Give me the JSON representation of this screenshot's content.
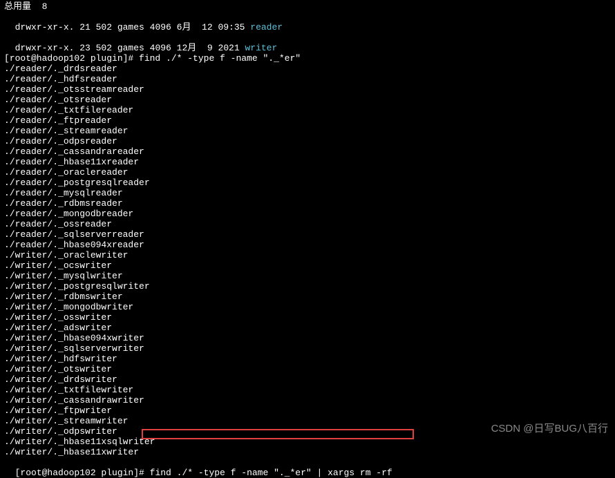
{
  "header": {
    "usage": "总用量  8",
    "ls1_prefix": "drwxr-xr-x. 21 502 games 4096 6月  12 09:35 ",
    "ls1_dir": "reader",
    "ls2_prefix": "drwxr-xr-x. 23 502 games 4096 12月  9 2021 ",
    "ls2_dir": "writer",
    "prompt1": "[root@hadoop102 plugin]# find ./* -type f -name \"._*er\""
  },
  "results": [
    "./reader/._drdsreader",
    "./reader/._hdfsreader",
    "./reader/._otsstreamreader",
    "./reader/._otsreader",
    "./reader/._txtfilereader",
    "./reader/._ftpreader",
    "./reader/._streamreader",
    "./reader/._odpsreader",
    "./reader/._cassandrareader",
    "./reader/._hbase11xreader",
    "./reader/._oraclereader",
    "./reader/._postgresqlreader",
    "./reader/._mysqlreader",
    "./reader/._rdbmsreader",
    "./reader/._mongodbreader",
    "./reader/._ossreader",
    "./reader/._sqlserverreader",
    "./reader/._hbase094xreader",
    "./writer/._oraclewriter",
    "./writer/._ocswriter",
    "./writer/._mysqlwriter",
    "./writer/._postgresqlwriter",
    "./writer/._rdbmswriter",
    "./writer/._mongodbwriter",
    "./writer/._osswriter",
    "./writer/._adswriter",
    "./writer/._hbase094xwriter",
    "./writer/._sqlserverwriter",
    "./writer/._hdfswriter",
    "./writer/._otswriter",
    "./writer/._drdswriter",
    "./writer/._txtfilewriter",
    "./writer/._cassandrawriter",
    "./writer/._ftpwriter",
    "./writer/._streamwriter",
    "./writer/._odpswriter",
    "./writer/._hbase11xsqlwriter",
    "./writer/._hbase11xwriter"
  ],
  "footer": {
    "prompt2_prefix": "[root@hadoop102 plugin]#",
    "prompt2_command": " find ./* -type f -name \"._*er\" | xargs rm -rf"
  },
  "watermark": "CSDN @日写BUG八百行"
}
